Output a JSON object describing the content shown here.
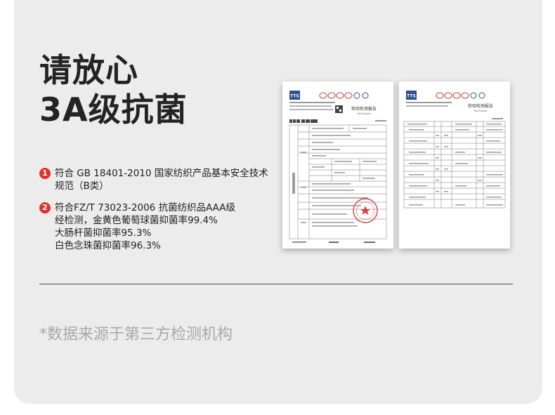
{
  "headline": {
    "line1": "请放心",
    "line2": "3A级抗菌"
  },
  "claims": [
    {
      "number": "1",
      "lines": [
        "符合 GB 18401-2010 国家纺织产品基本安全技术",
        "规范（B类）"
      ]
    },
    {
      "number": "2",
      "lines": [
        "符合FZ/T 73023-2006 抗菌纺织品AAA级",
        "经检测，金黄色葡萄球菌抑菌率99.4%",
        "大肠杆菌抑菌率95.3%",
        "白色念珠菌抑菌率96.3%"
      ]
    }
  ],
  "reports": {
    "logo_text": "TTS",
    "title": "检验检测报告",
    "subtitle": "Test Report"
  },
  "footnote": "*数据来源于第三方检测机构",
  "colors": {
    "accent": "#e0322a",
    "background": "#ececec",
    "headline": "#232323",
    "footnote": "#a8a8a8"
  }
}
